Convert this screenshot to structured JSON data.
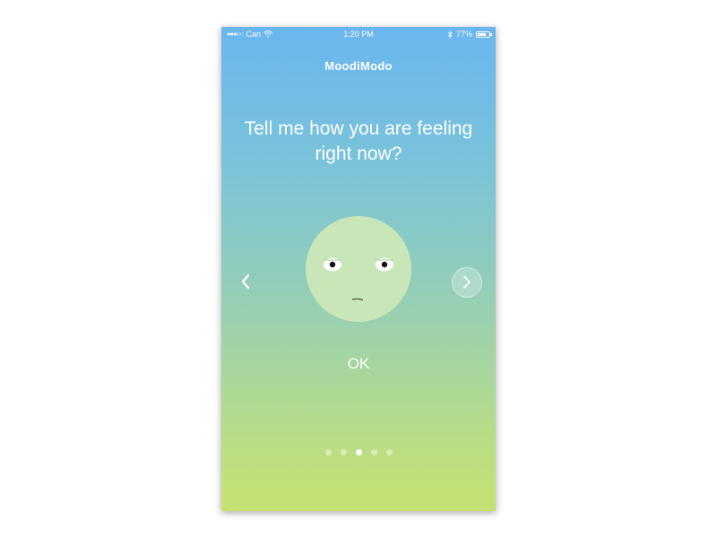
{
  "status_bar": {
    "signal": "●●●○○",
    "carrier": "Can",
    "time": "1:20 PM",
    "battery_percent_text": "77%",
    "battery_level": 0.77
  },
  "app": {
    "title": "MoodiModo"
  },
  "screen": {
    "question": "Tell me how you are feeling right now?",
    "ok_label": "OK",
    "face_color": "#c8e6b8",
    "page_count": 5,
    "active_page": 3
  },
  "icons": {
    "prev": "chevron-left-icon",
    "next": "chevron-right-icon",
    "wifi": "wifi-icon",
    "bluetooth": "bluetooth-icon",
    "battery": "battery-icon"
  }
}
